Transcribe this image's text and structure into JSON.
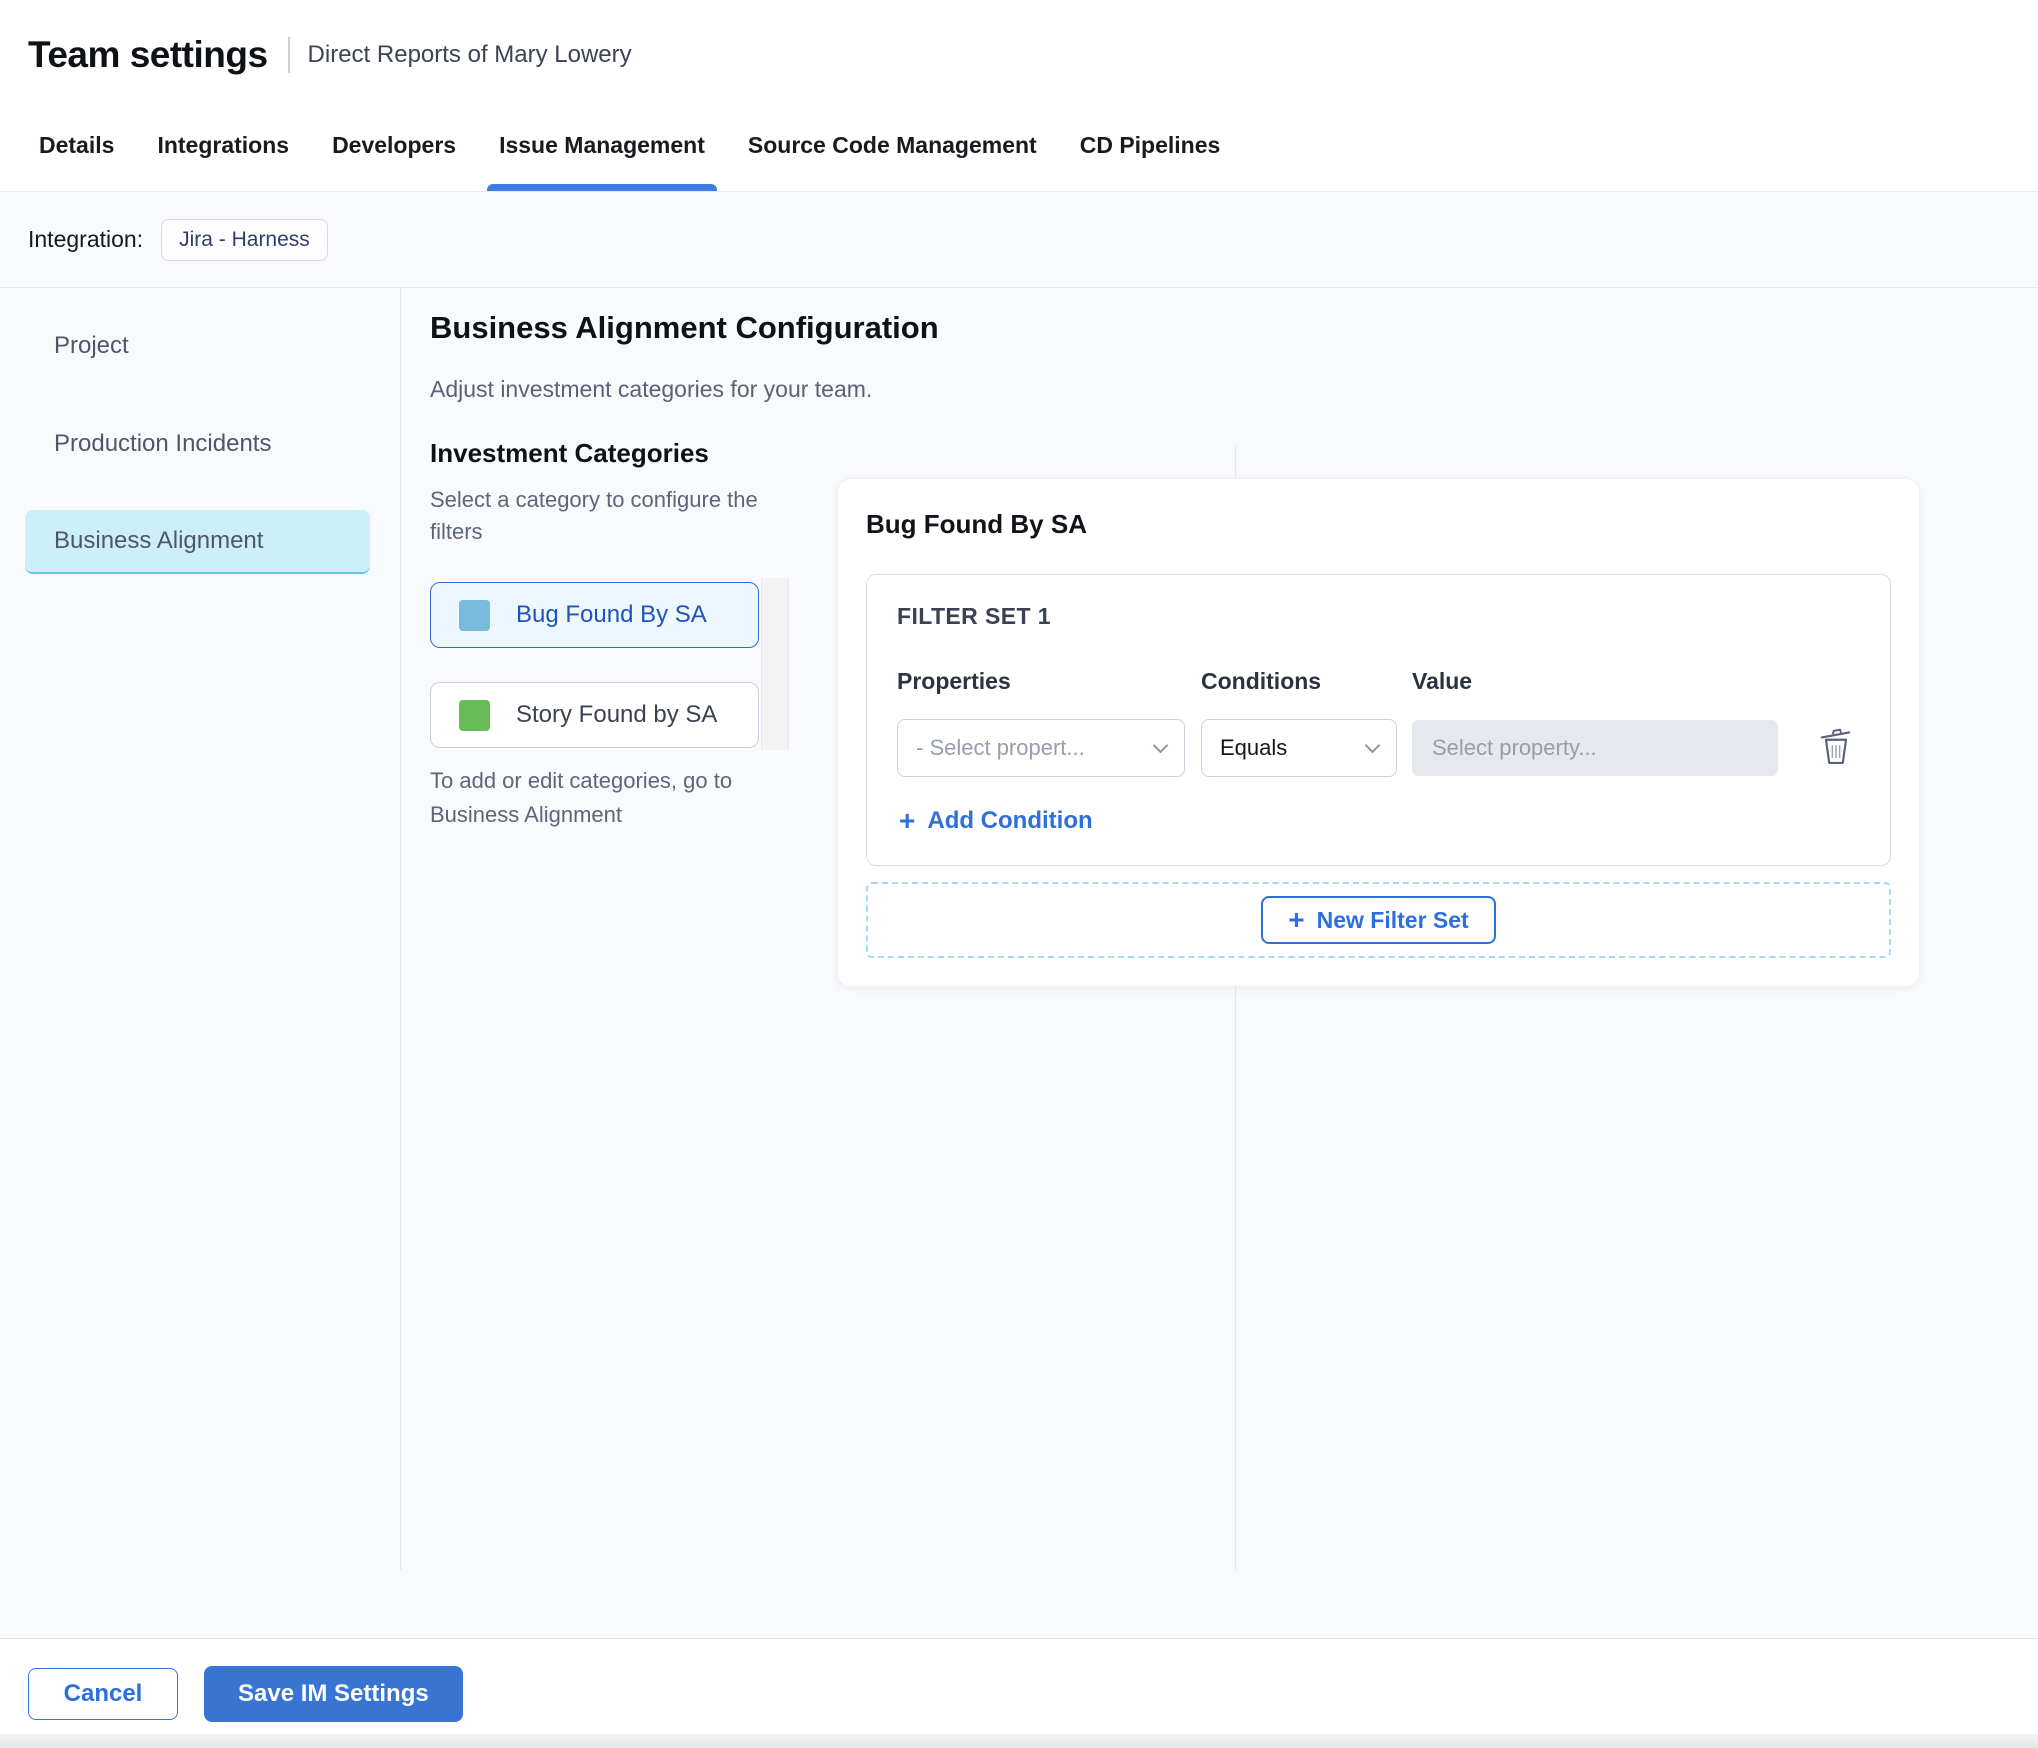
{
  "header": {
    "title": "Team settings",
    "subtitle": "Direct Reports of Mary Lowery"
  },
  "tabs": [
    {
      "label": "Details",
      "active": false
    },
    {
      "label": "Integrations",
      "active": false
    },
    {
      "label": "Developers",
      "active": false
    },
    {
      "label": "Issue Management",
      "active": true
    },
    {
      "label": "Source Code Management",
      "active": false
    },
    {
      "label": "CD Pipelines",
      "active": false
    }
  ],
  "integration": {
    "label": "Integration:",
    "value": "Jira - Harness"
  },
  "sidebar": {
    "items": [
      {
        "label": "Project",
        "active": false
      },
      {
        "label": "Production Incidents",
        "active": false
      },
      {
        "label": "Business Alignment",
        "active": true
      }
    ]
  },
  "main": {
    "title": "Business Alignment Configuration",
    "subtitle": "Adjust investment categories for your team.",
    "categories": {
      "heading": "Investment Categories",
      "hint": "Select a category to configure the filters",
      "items": [
        {
          "label": "Bug Found By SA",
          "swatch_color": "#7abadd",
          "selected": true
        },
        {
          "label": "Story Found by SA",
          "swatch_color": "#67bb58",
          "selected": false
        }
      ],
      "note": "To add or edit categories, go to Business Alignment"
    },
    "panel": {
      "title": "Bug Found By SA",
      "filter_set": {
        "label": "FILTER SET 1",
        "columns": [
          "Properties",
          "Conditions",
          "Value"
        ],
        "property_placeholder": "- Select propert...",
        "condition_value": "Equals",
        "value_placeholder": "Select property..."
      },
      "add_condition_label": "Add Condition",
      "new_filter_set_label": "New Filter Set"
    }
  },
  "footer": {
    "cancel_label": "Cancel",
    "save_label": "Save IM Settings"
  },
  "colors": {
    "tab_underline": "#3d7ce2",
    "accent_blue": "#2e6fdd",
    "sidebar_active_bg": "#cdeefb",
    "selected_category_bg": "#eef7fd",
    "selected_category_border": "#2f6bd9",
    "bug_swatch": "#7abadd",
    "story_swatch": "#67bb58",
    "save_button_bg": "#3875d2"
  }
}
